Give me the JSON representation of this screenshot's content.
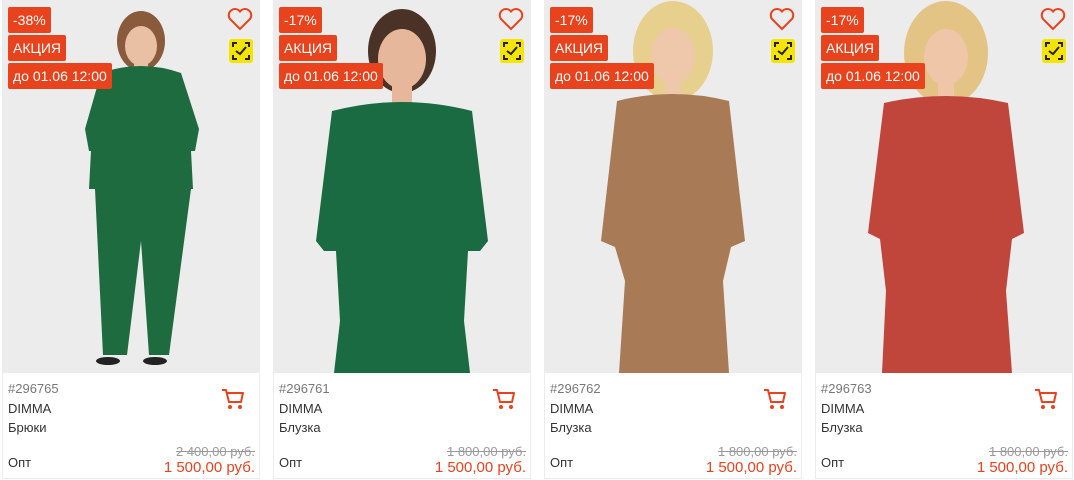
{
  "colors": {
    "accent": "#e8431c",
    "qr_badge": "#f5e400",
    "heart": "#e8431c"
  },
  "icons": {
    "favorite": "heart-icon",
    "qr": "qr-scan-icon",
    "cart": "cart-icon"
  },
  "products": [
    {
      "discount": "-38%",
      "promo_label": "АКЦИЯ",
      "promo_until": "до 01.06 12:00",
      "sku": "#296765",
      "brand": "DIMMA",
      "type": "Брюки",
      "price_label": "Опт",
      "old_price": "2 400,00 руб.",
      "new_price": "1 500,00 руб.",
      "garment_color": "#1d6b3f"
    },
    {
      "discount": "-17%",
      "promo_label": "АКЦИЯ",
      "promo_until": "до 01.06 12:00",
      "sku": "#296761",
      "brand": "DIMMA",
      "type": "Блузка",
      "price_label": "Опт",
      "old_price": "1 800,00 руб.",
      "new_price": "1 500,00 руб.",
      "garment_color": "#1a6a42"
    },
    {
      "discount": "-17%",
      "promo_label": "АКЦИЯ",
      "promo_until": "до 01.06 12:00",
      "sku": "#296762",
      "brand": "DIMMA",
      "type": "Блузка",
      "price_label": "Опт",
      "old_price": "1 800,00 руб.",
      "new_price": "1 500,00 руб.",
      "garment_color": "#a87a55"
    },
    {
      "discount": "-17%",
      "promo_label": "АКЦИЯ",
      "promo_until": "до 01.06 12:00",
      "sku": "#296763",
      "brand": "DIMMA",
      "type": "Блузка",
      "price_label": "Опт",
      "old_price": "1 800,00 руб.",
      "new_price": "1 500,00 руб.",
      "garment_color": "#c0453a"
    }
  ]
}
